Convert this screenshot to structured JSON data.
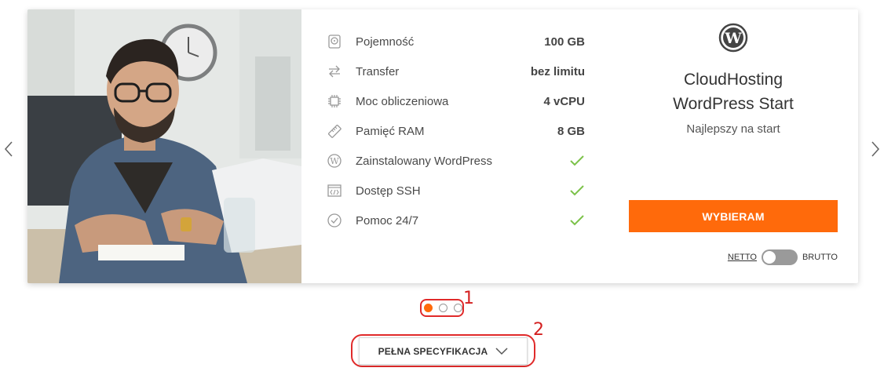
{
  "carousel": {
    "prev_icon": "chevron-left-icon",
    "next_icon": "chevron-right-icon",
    "active_index": 1,
    "dot_count": 3
  },
  "specs": [
    {
      "icon": "hdd-icon",
      "label": "Pojemność",
      "value": "100 GB"
    },
    {
      "icon": "transfer-arrows-icon",
      "label": "Transfer",
      "value": "bez limitu"
    },
    {
      "icon": "cpu-icon",
      "label": "Moc obliczeniowa",
      "value": "4 vCPU"
    },
    {
      "icon": "ram-icon",
      "label": "Pamięć RAM",
      "value": "8 GB"
    },
    {
      "icon": "wordpress-icon",
      "label": "Zainstalowany WordPress",
      "value": "✓"
    },
    {
      "icon": "code-window-icon",
      "label": "Dostęp SSH",
      "value": "✓"
    },
    {
      "icon": "check-circle-icon",
      "label": "Pomoc 24/7",
      "value": "✓"
    }
  ],
  "offer": {
    "logo_icon": "wordpress-logo-icon",
    "title_line1": "CloudHosting",
    "title_line2": "WordPress Start",
    "subtitle": "Najlepszy na start",
    "button_label": "WYBIERAM",
    "toggle_left": "NETTO",
    "toggle_right": "BRUTTO"
  },
  "annotations": {
    "dots_marker": "1",
    "spec_marker": "2"
  },
  "spec_button": {
    "label": "PEŁNA SPECYFIKACJA"
  },
  "colors": {
    "accent": "#ff6a0b",
    "check": "#7cc24a",
    "annotation": "#e02a2a"
  }
}
